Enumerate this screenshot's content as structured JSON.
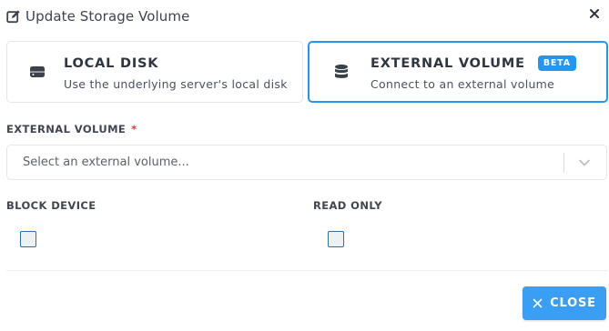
{
  "dialog": {
    "title": "Update Storage Volume"
  },
  "options": {
    "local": {
      "title": "LOCAL DISK",
      "description": "Use the underlying server's local disk",
      "icon": "hard-drive-icon"
    },
    "external": {
      "title": "EXTERNAL VOLUME",
      "badge": "BETA",
      "description": "Connect to an external volume",
      "icon": "database-icon",
      "selected": true
    }
  },
  "fields": {
    "external_volume": {
      "label": "EXTERNAL VOLUME",
      "required_mark": "*",
      "placeholder": "Select an external volume...",
      "value": ""
    },
    "block_device": {
      "label": "BLOCK DEVICE",
      "checked": false
    },
    "read_only": {
      "label": "READ ONLY",
      "checked": false
    }
  },
  "footer": {
    "close_label": "CLOSE"
  },
  "colors": {
    "accent": "#2196f3",
    "button": "#3a9ef5",
    "required": "#e53935"
  }
}
